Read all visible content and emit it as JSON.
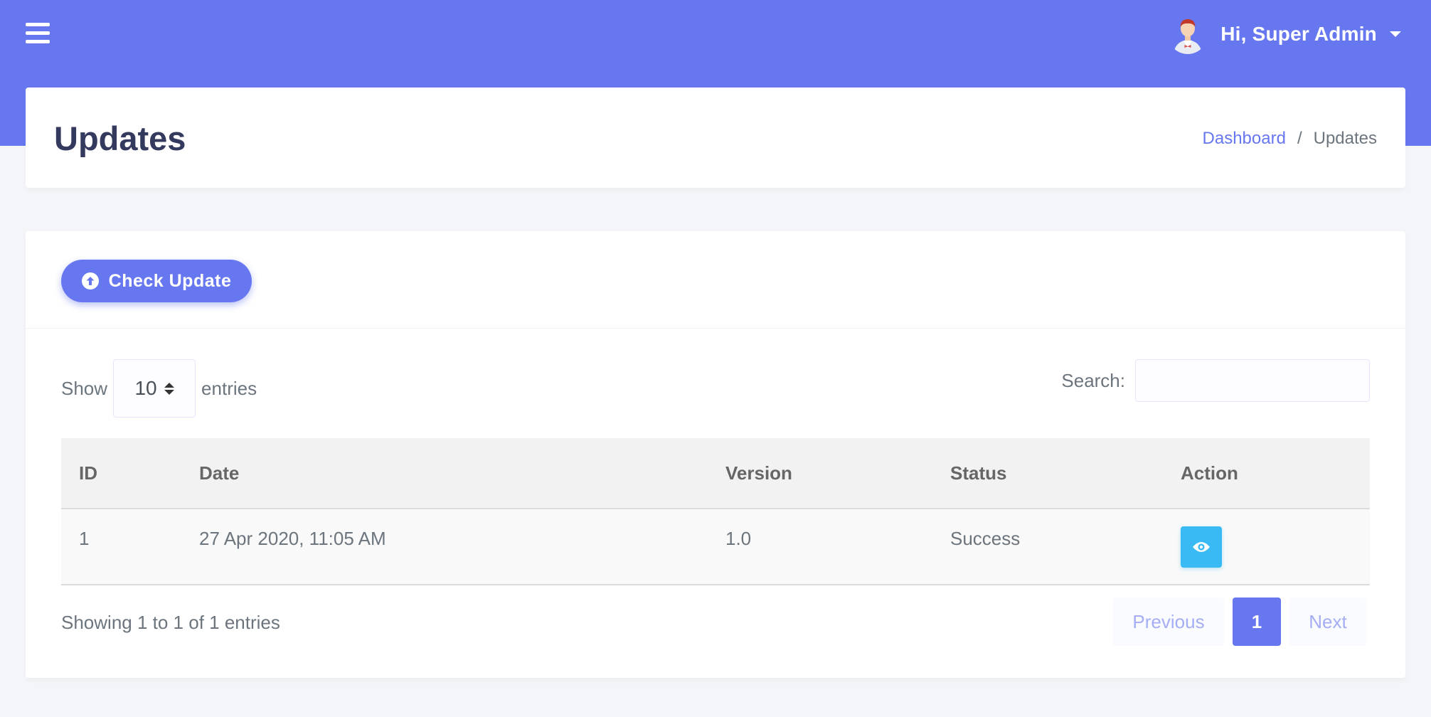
{
  "navbar": {
    "menu_icon": "hamburger-icon",
    "user_greeting": "Hi, Super Admin",
    "user_icon": "avatar-icon",
    "dropdown_icon": "caret-down-icon"
  },
  "header": {
    "title": "Updates",
    "breadcrumb": {
      "link": "Dashboard",
      "separator": "/",
      "current": "Updates"
    }
  },
  "card": {
    "check_button": {
      "label": "Check Update",
      "icon": "arrow-up-circle-icon"
    },
    "length": {
      "prefix": "Show",
      "value": "10",
      "suffix": "entries"
    },
    "search": {
      "label": "Search:",
      "value": ""
    },
    "table": {
      "headers": {
        "id": "ID",
        "date": "Date",
        "version": "Version",
        "status": "Status",
        "action": "Action"
      },
      "rows": [
        {
          "id": "1",
          "date": "27 Apr 2020, 11:05 AM",
          "version": "1.0",
          "status": "Success",
          "action_icon": "eye-icon"
        }
      ]
    },
    "info": "Showing 1 to 1 of 1 entries",
    "pagination": {
      "previous": "Previous",
      "current": "1",
      "next": "Next"
    }
  },
  "colors": {
    "primary": "#6777ef",
    "info": "#3abaf4",
    "title": "#34395e"
  }
}
